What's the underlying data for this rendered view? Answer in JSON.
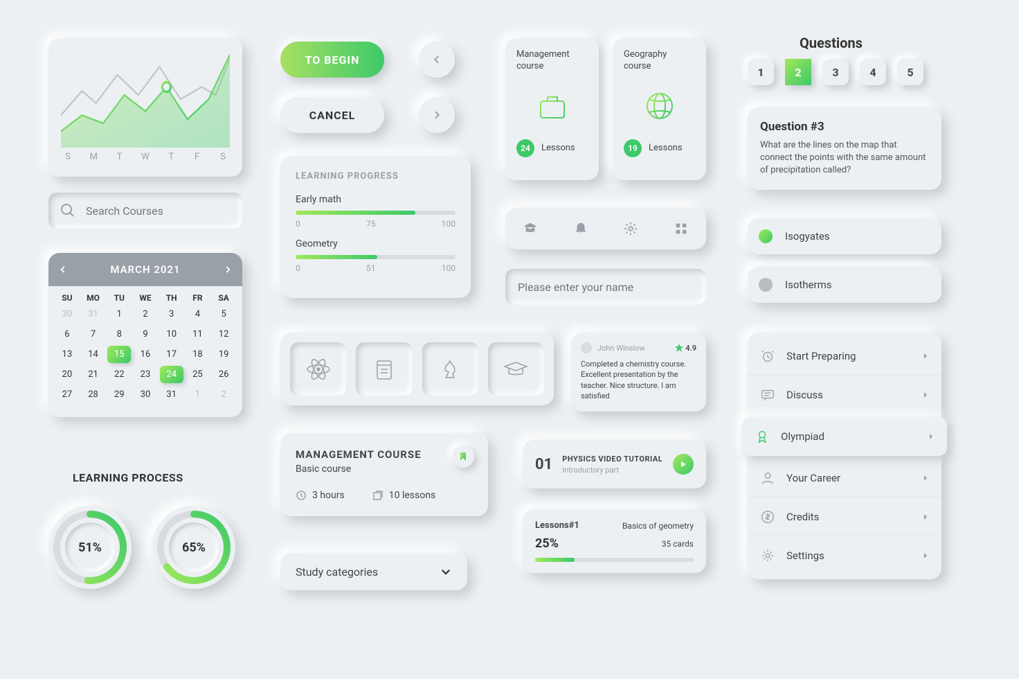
{
  "chart": {
    "days": [
      "S",
      "M",
      "T",
      "W",
      "T",
      "F",
      "S"
    ]
  },
  "search": {
    "placeholder": "Search Courses"
  },
  "calendar": {
    "month": "MARCH 2021",
    "dow": [
      "SU",
      "MO",
      "TU",
      "WE",
      "TH",
      "FR",
      "SA"
    ],
    "selected": [
      15,
      24
    ],
    "lead_muted": [
      30,
      31
    ],
    "trail_muted": [
      1,
      2
    ],
    "first_day_index": 2,
    "num_days": 31
  },
  "learning_process": {
    "title": "LEARNING PROCESS",
    "donut1": "51%",
    "donut1_val": 51,
    "donut2": "65%",
    "donut2_val": 65
  },
  "buttons": {
    "begin": "TO BEGIN",
    "cancel": "CANCEL"
  },
  "progress": {
    "title": "LEARNING PROGRESS",
    "items": [
      {
        "label": "Early math",
        "value": 75,
        "min": "0",
        "max": "100"
      },
      {
        "label": "Geometry",
        "value": 51,
        "min": "0",
        "max": "100"
      }
    ]
  },
  "icon_row": [
    "atom-icon",
    "book-icon",
    "chess-icon",
    "grad-cap-icon"
  ],
  "course_detail": {
    "title": "MANAGEMENT COURSE",
    "subtitle": "Basic course",
    "duration": "3 hours",
    "lessons": "10 lessons"
  },
  "study_categories": {
    "label": "Study categories"
  },
  "courses": {
    "mgmt": {
      "title": "Management course",
      "count": "24",
      "label": "Lessons"
    },
    "geo": {
      "title": "Geography course",
      "count": "19",
      "label": "Lessons"
    }
  },
  "toolbar_icons": [
    "grad-cap-icon",
    "bell-icon",
    "gear-icon",
    "grid-icon"
  ],
  "name_input": {
    "placeholder": "Please enter your name"
  },
  "review": {
    "name": "John Winslow",
    "rating": "4.9",
    "text": "Completed a chemistry course. Excellent presentation by the teacher. Nice structure. I am satisfied"
  },
  "video": {
    "num": "01",
    "title": "PHYSICS VIDEO TUTORIAL",
    "sub": "Introductory part"
  },
  "lesson": {
    "title": "Lessons#1",
    "subject": "Basics of geometry",
    "pct": "25%",
    "pct_val": 25,
    "cards": "35 cards"
  },
  "quiz": {
    "heading": "Questions",
    "numbers": [
      "1",
      "2",
      "3",
      "4",
      "5"
    ],
    "active_index": 1,
    "question_title": "Question #3",
    "question_text": "What are the lines on the map that connect the points with the same amount of precipitation called?",
    "answers": [
      {
        "label": "Isogyates",
        "selected": true
      },
      {
        "label": "Isotherms",
        "selected": false
      }
    ]
  },
  "menu": {
    "items": [
      {
        "label": "Start Preparing",
        "icon": "alarm"
      },
      {
        "label": "Discuss",
        "icon": "chat"
      },
      {
        "label": "Olympiad",
        "icon": "medal",
        "active": true
      },
      {
        "label": "Your Career",
        "icon": "user"
      },
      {
        "label": "Credits",
        "icon": "coin"
      },
      {
        "label": "Settings",
        "icon": "gear"
      }
    ]
  },
  "colors": {
    "accent_start": "#a0e85a",
    "accent_end": "#3dc96a",
    "text_muted": "#9aa0a8"
  }
}
